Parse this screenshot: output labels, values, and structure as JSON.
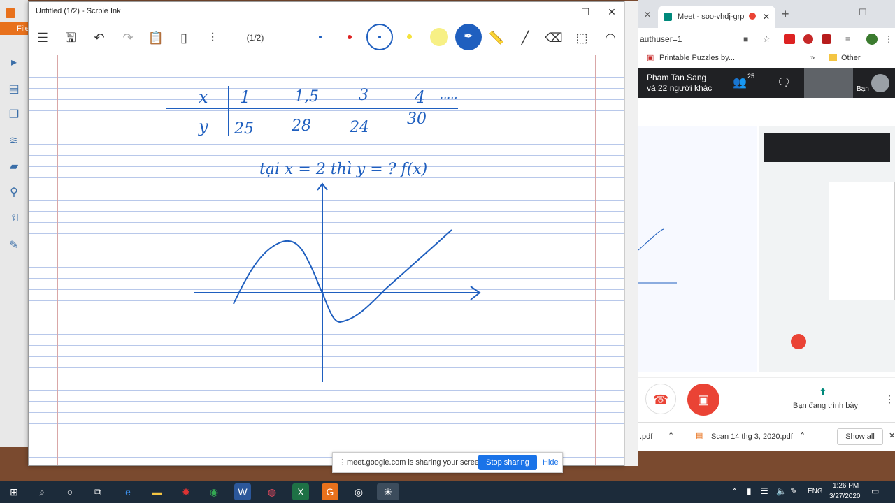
{
  "ink": {
    "title": "Untitled (1/2) - Scrble Ink",
    "page_indicator": "(1/2)",
    "handwriting": {
      "table_x_label": "x",
      "table_y_label": "y",
      "x_values": [
        "1",
        "1,5",
        "3",
        "4",
        "....."
      ],
      "y_values": [
        "25",
        "28",
        "24",
        "30"
      ],
      "question": "tại x = 2  thì y = ?  f(x)"
    }
  },
  "bgapp": {
    "menu_label": "File"
  },
  "chrome": {
    "tab_title": "Meet - soo-vhdj-grp",
    "address": "authuser=1",
    "bookmark1": "Printable Puzzles by...",
    "bookmark_more": "»",
    "other_bookmarks": "Other bookmarks",
    "participant_name": "Pham Tan Sang",
    "participant_more": "và 22 người khác",
    "participant_count": "25",
    "you_label": "Bạn",
    "presenting_label": "Bạn đang trình bày",
    "download1": ".pdf",
    "download2": "Scan 14 thg 3, 2020.pdf",
    "show_all": "Show all"
  },
  "share": {
    "text": "meet.google.com is sharing your screen.",
    "stop": "Stop sharing",
    "hide": "Hide"
  },
  "taskbar": {
    "time": "1:26 PM",
    "date": "3/27/2020",
    "lang": "ENG"
  },
  "colors": {
    "ink_blue": "#1f5fbf",
    "meet_red": "#ea4335",
    "chrome_blue": "#1a73e8"
  }
}
